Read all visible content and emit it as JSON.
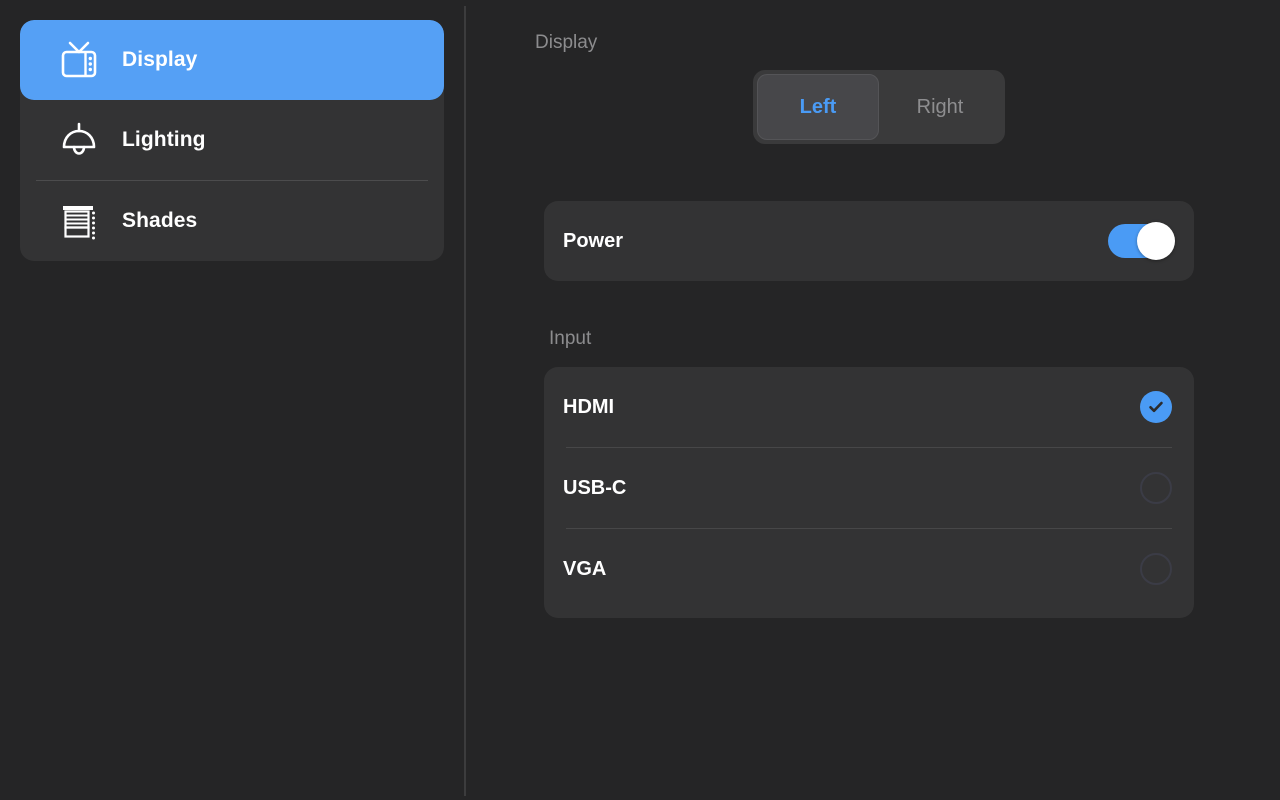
{
  "theme": {
    "background": "#252526",
    "card": "#333334",
    "accent": "#4a9bf5",
    "selected_nav": "#55a0f5",
    "muted_text": "#8c8c8e",
    "divider": "#474748"
  },
  "sidebar": {
    "items": [
      {
        "label": "Display",
        "icon": "tv-icon",
        "selected": true
      },
      {
        "label": "Lighting",
        "icon": "lamp-icon",
        "selected": false
      },
      {
        "label": "Shades",
        "icon": "blinds-icon",
        "selected": false
      }
    ]
  },
  "content": {
    "display_section": {
      "header": "Display",
      "segmented_control": {
        "options": [
          "Left",
          "Right"
        ],
        "selected": "Left"
      },
      "power_row": {
        "label": "Power",
        "toggle_state": "on"
      }
    },
    "input_section": {
      "header": "Input",
      "options": [
        {
          "label": "HDMI",
          "selected": true
        },
        {
          "label": "USB-C",
          "selected": false
        },
        {
          "label": "VGA",
          "selected": false
        }
      ]
    }
  }
}
